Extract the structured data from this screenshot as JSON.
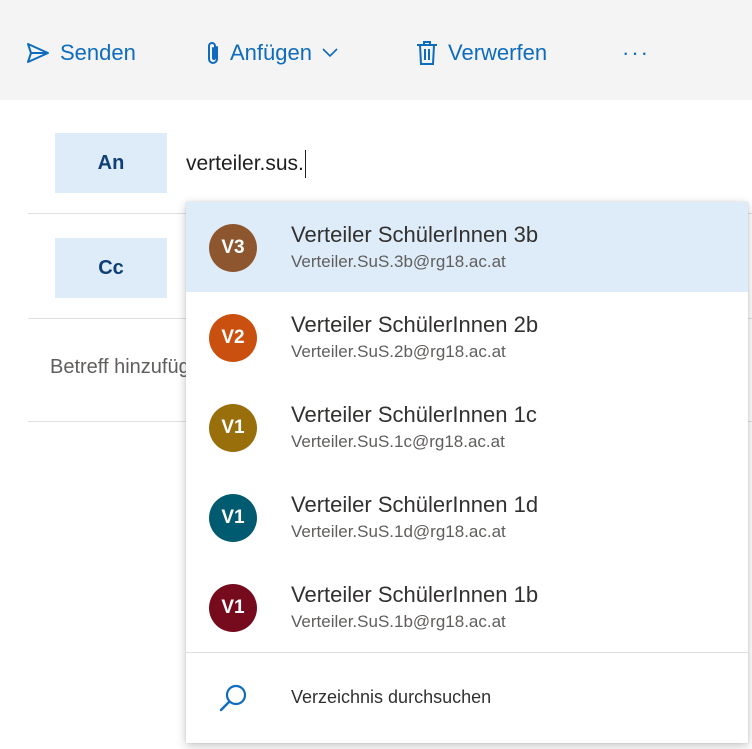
{
  "toolbar": {
    "send_label": "Senden",
    "attach_label": "Anfügen",
    "discard_label": "Verwerfen",
    "more_label": "···"
  },
  "fields": {
    "to_label": "An",
    "to_value": "verteiler.sus.",
    "cc_label": "Cc",
    "subject_placeholder": "Betreff hinzufügen"
  },
  "suggestions": [
    {
      "initials": "V3",
      "name": "Verteiler SchülerInnen 3b",
      "email": "Verteiler.SuS.3b@rg18.ac.at",
      "color": "#8e562e",
      "selected": true
    },
    {
      "initials": "V2",
      "name": "Verteiler SchülerInnen 2b",
      "email": "Verteiler.SuS.2b@rg18.ac.at",
      "color": "#ca5010",
      "selected": false
    },
    {
      "initials": "V1",
      "name": "Verteiler SchülerInnen 1c",
      "email": "Verteiler.SuS.1c@rg18.ac.at",
      "color": "#986f0b",
      "selected": false
    },
    {
      "initials": "V1",
      "name": "Verteiler SchülerInnen 1d",
      "email": "Verteiler.SuS.1d@rg18.ac.at",
      "color": "#005b70",
      "selected": false
    },
    {
      "initials": "V1",
      "name": "Verteiler SchülerInnen 1b",
      "email": "Verteiler.SuS.1b@rg18.ac.at",
      "color": "#750b1c",
      "selected": false
    }
  ],
  "directory_search": {
    "label": "Verzeichnis durchsuchen",
    "icon": "search-icon"
  },
  "colors": {
    "accent": "#0f6cbd",
    "field_button_bg": "#deecf9",
    "selected_bg": "#deecf9"
  }
}
